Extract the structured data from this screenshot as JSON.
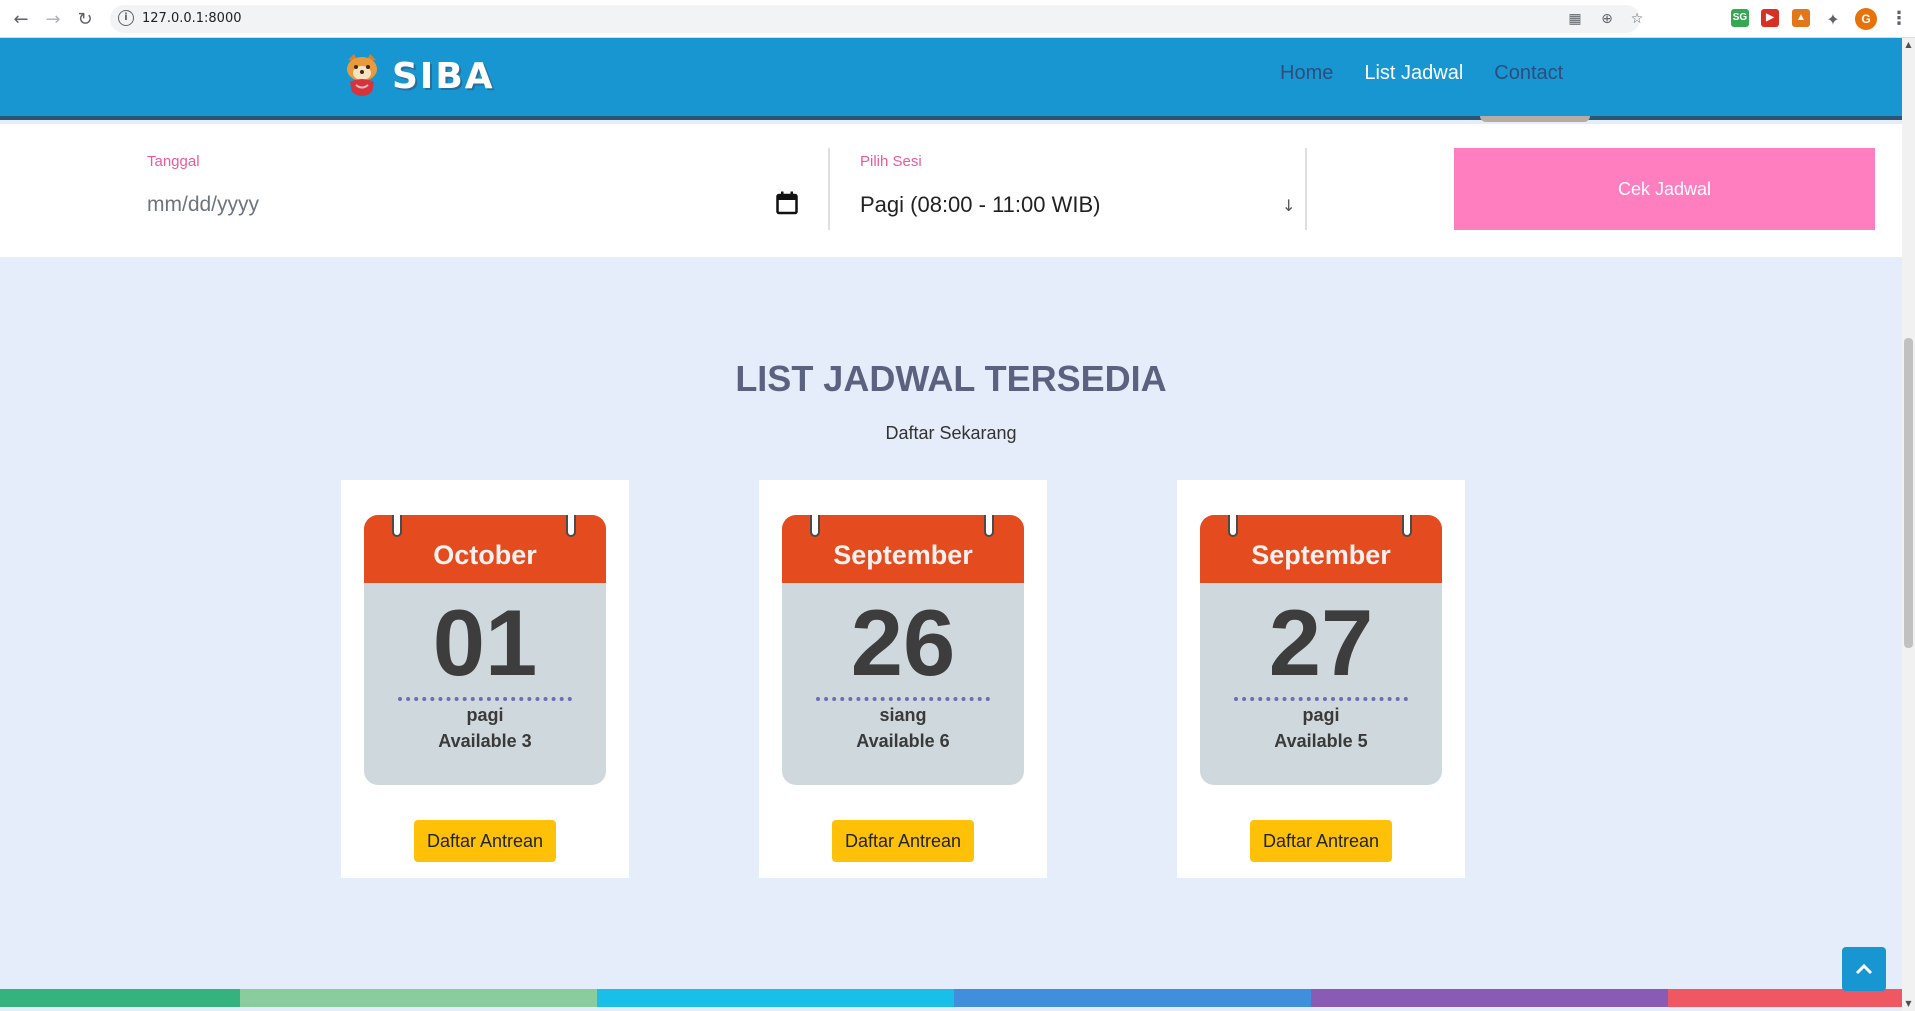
{
  "browser": {
    "url": "127.0.0.1:8000",
    "profile_initial": "G",
    "ext_sg": "SG"
  },
  "site": {
    "brand": "SIBA",
    "nav": [
      {
        "label": "Home"
      },
      {
        "label": "List Jadwal"
      },
      {
        "label": "Contact"
      }
    ]
  },
  "search": {
    "date_label": "Tanggal",
    "date_placeholder": "mm/dd/yyyy",
    "session_label": "Pilih Sesi",
    "session_value": "Pagi (08:00 - 11:00 WIB)",
    "submit_label": "Cek Jadwal"
  },
  "section": {
    "title": "LIST JADWAL TERSEDIA",
    "subtitle": "Daftar Sekarang"
  },
  "cards": [
    {
      "month": "October",
      "day": "01",
      "session": "pagi",
      "available": "Available 3",
      "button": "Daftar Antrean"
    },
    {
      "month": "September",
      "day": "26",
      "session": "siang",
      "available": "Available 6",
      "button": "Daftar Antrean"
    },
    {
      "month": "September",
      "day": "27",
      "session": "pagi",
      "available": "Available 5",
      "button": "Daftar Antrean"
    }
  ],
  "colors": {
    "navbar": "#1796d1",
    "accent_pink": "#ff7ec0",
    "calendar_header": "#e44b1e",
    "button_yellow": "#ffc107",
    "page_bg": "#e5ecfa",
    "bottom_bar": [
      "#35b37e",
      "#8acc9e",
      "#19bfe9",
      "#3f8fdc",
      "#8a5bb5",
      "#ef5862"
    ]
  }
}
